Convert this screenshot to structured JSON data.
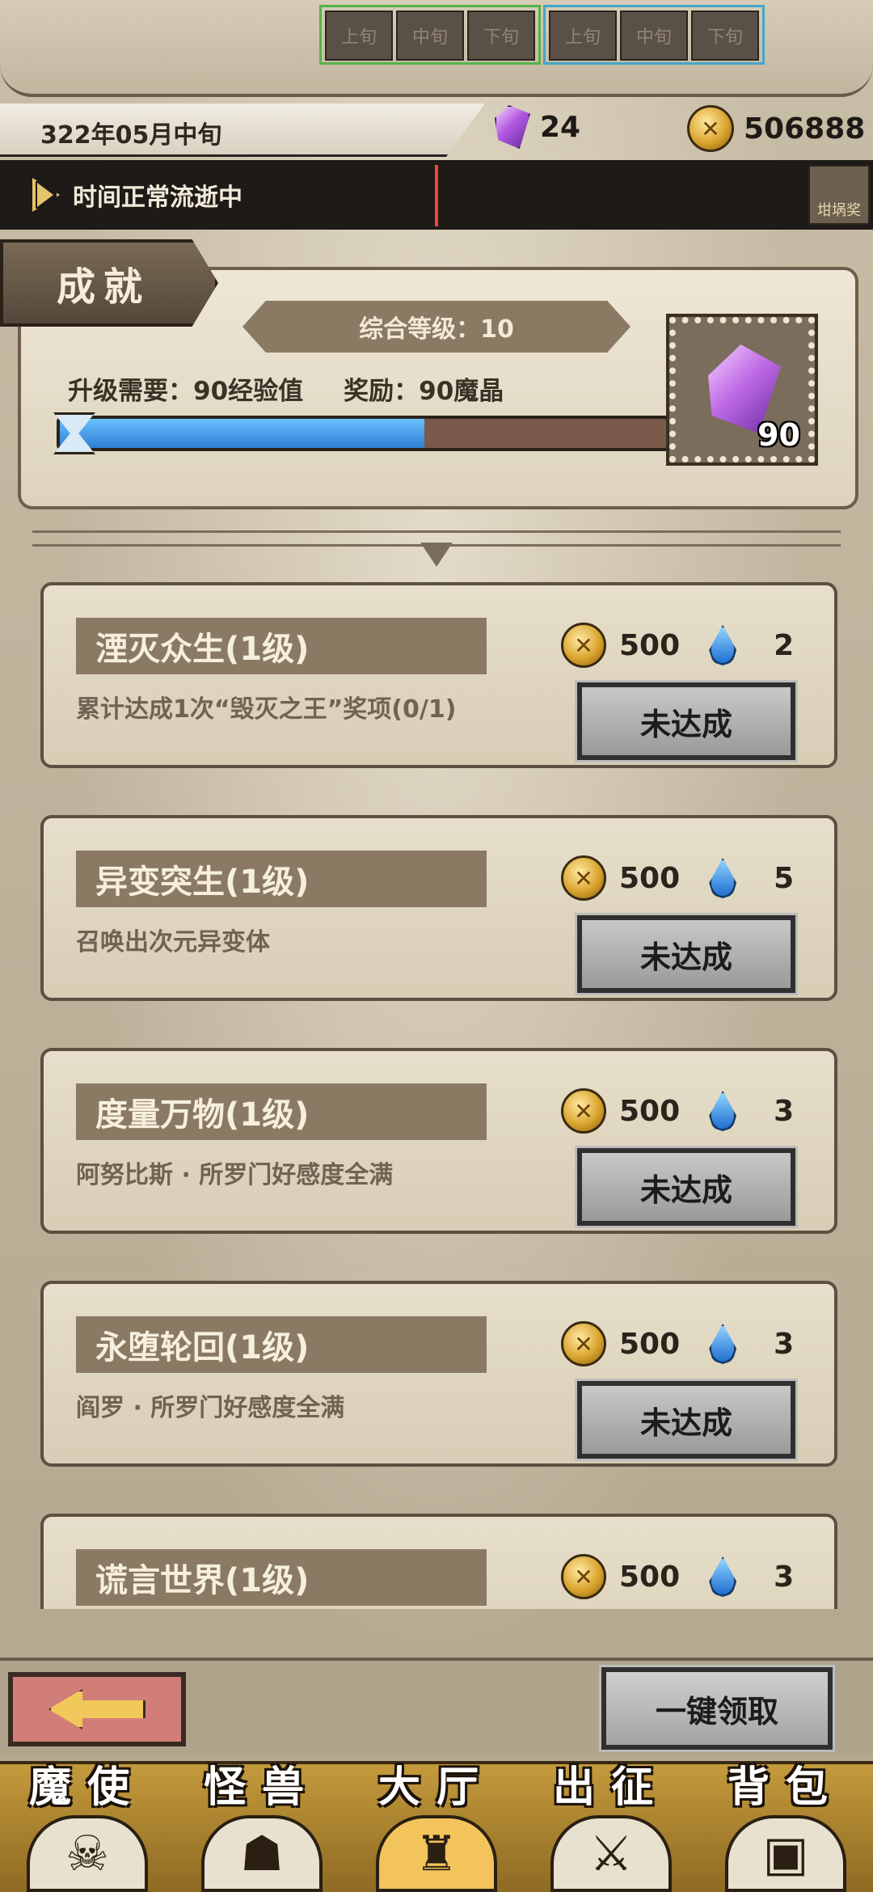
{
  "header": {
    "date": "322年05月中旬",
    "crystals": "24",
    "coins": "506888"
  },
  "time_bar": {
    "status": "时间正常流逝中",
    "slots_current": [
      "上旬",
      "中旬",
      "下旬"
    ],
    "slots_next": [
      "上旬",
      "中旬",
      "下旬"
    ],
    "reward_label": "坩埚奖"
  },
  "tab": {
    "title": "成就"
  },
  "level": {
    "title": "综合等级：10",
    "requirement": "升级需要：90经验值",
    "reward": "奖励：90魔晶",
    "progress": 0.6,
    "reward_qty": "90"
  },
  "achievements": [
    {
      "title": "湮灭众生(1级)",
      "desc": "累计达成1次“毁灭之王”奖项(0/1)",
      "coins": "500",
      "drops": "2",
      "status": "未达成"
    },
    {
      "title": "异变突生(1级)",
      "desc": "召唤出次元异变体",
      "coins": "500",
      "drops": "5",
      "status": "未达成"
    },
    {
      "title": "度量万物(1级)",
      "desc": "阿努比斯 · 所罗门好感度全满",
      "coins": "500",
      "drops": "3",
      "status": "未达成"
    },
    {
      "title": "永堕轮回(1级)",
      "desc": "阎罗 · 所罗门好感度全满",
      "coins": "500",
      "drops": "3",
      "status": "未达成"
    },
    {
      "title": "谎言世界(1级)",
      "desc": "",
      "coins": "500",
      "drops": "3",
      "status": ""
    }
  ],
  "actions": {
    "claim_all": "一键领取"
  },
  "nav": [
    {
      "label": "魔使",
      "icon": "skull-icon"
    },
    {
      "label": "怪兽",
      "icon": "monster-icon"
    },
    {
      "label": "大厅",
      "icon": "hall-icon"
    },
    {
      "label": "出征",
      "icon": "expedition-icon"
    },
    {
      "label": "背包",
      "icon": "backpack-icon"
    }
  ],
  "colors": {
    "accent_gold": "#c49a3c",
    "progress_blue": "#2f7fd4",
    "slot_green": "#54b34a",
    "slot_blue": "#44a6c9"
  }
}
